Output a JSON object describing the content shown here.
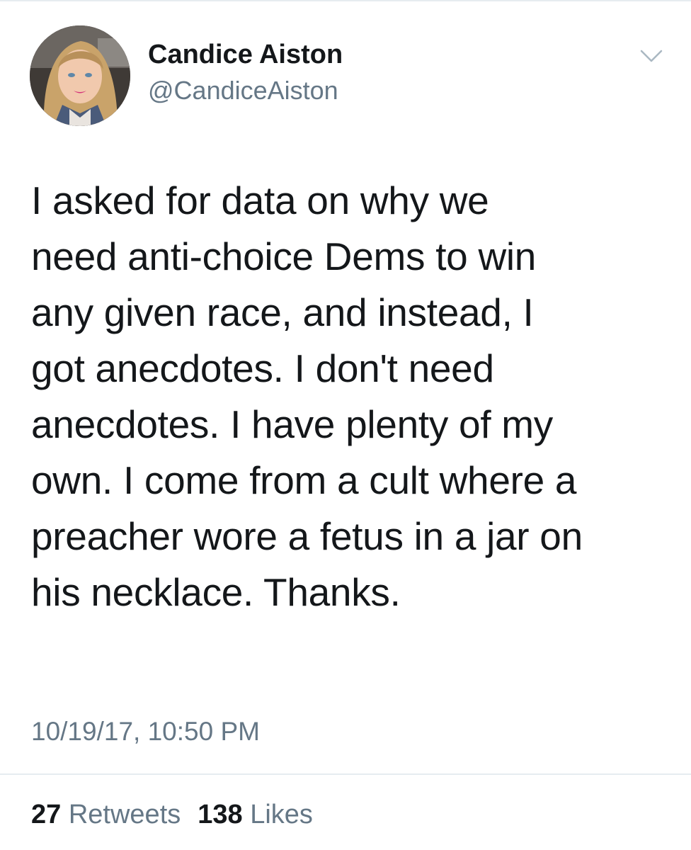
{
  "user": {
    "display_name": "Candice Aiston",
    "handle": "@CandiceAiston",
    "avatar_icon": "profile-photo"
  },
  "menu": {
    "icon": "chevron-down-icon"
  },
  "tweet": {
    "text": "I asked for data on why we\nneed anti-choice Dems to win\nany given race, and instead, I\ngot anecdotes. I don't need\nanecdotes. I have plenty of my\nown. I come from a cult where a\npreacher wore a fetus in a jar on\nhis necklace. Thanks.",
    "timestamp": "10/19/17, 10:50 PM"
  },
  "stats": {
    "retweets_count": "27",
    "retweets_label": "Retweets",
    "likes_count": "138",
    "likes_label": "Likes"
  },
  "colors": {
    "text_primary": "#14171a",
    "text_secondary": "#657786",
    "divider": "#e6ecf0"
  }
}
